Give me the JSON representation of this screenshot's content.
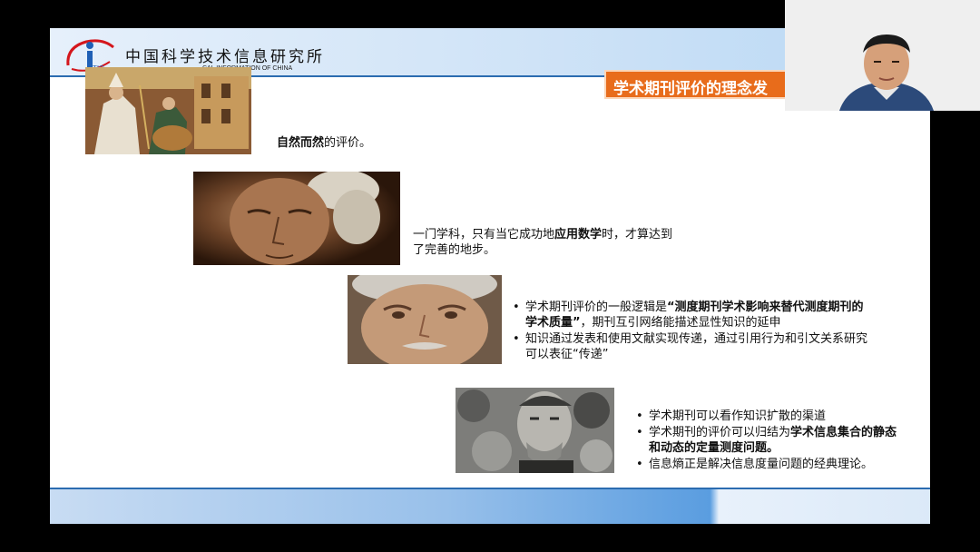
{
  "slide": {
    "header": {
      "org_name_cn": "中国科学技术信息研究所",
      "org_name_en": "CAL INFORMATION OF CHINA",
      "logo_text": "TIC",
      "section_title": "学术期刊评价的理念发"
    },
    "items": [
      {
        "text_before": "",
        "bold": "自然而然",
        "text_after": "的评价。"
      },
      {
        "text_before": "一门学科，只有当它成功地",
        "bold": "应用数学",
        "text_after": "时，才算达到了完善的地步。"
      }
    ],
    "bullets_1": [
      {
        "text_before": "学术期刊评价的一般逻辑是",
        "bold": "“测度期刊学术影响来替代测度期刊的学术质量”",
        "text_after": "，期刊互引网络能描述显性知识的延申"
      },
      {
        "text_before": "知识通过发表和使用文献实现传递，通过引用行为和引文关系研究可以表征“传递”",
        "bold": "",
        "text_after": ""
      }
    ],
    "bullets_2": [
      {
        "text_before": "学术期刊可以看作知识扩散的渠道",
        "bold": "",
        "text_after": ""
      },
      {
        "text_before": "学术期刊的评价可以归结为",
        "bold": "学术信息集合的静态和动态的定量测度问题。",
        "text_after": ""
      },
      {
        "text_before": "信息熵正是解决信息度量问题的经典理论。",
        "bold": "",
        "text_after": ""
      }
    ]
  },
  "colors": {
    "title_tag": "#e86c1b",
    "header_rule": "#2b6cb0",
    "logo_red": "#d4161c",
    "logo_blue": "#1f5fb5"
  }
}
